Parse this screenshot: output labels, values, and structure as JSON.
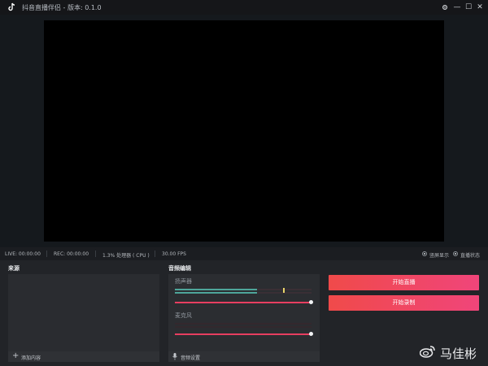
{
  "titlebar": {
    "title": "抖音直播伴侣 - 版本: 0.1.0",
    "buttons": {
      "settings_icon": "gear-icon",
      "minimize": "—",
      "maximize": "☐",
      "close": "✕"
    }
  },
  "statusbar": {
    "live": "LIVE: 00:00:00",
    "rec": "REC: 00:00:00",
    "cpu": "1.3% 处理器 ( CPU )",
    "fps": "30.00 FPS",
    "options": [
      {
        "label": "竖屏显示",
        "selected": true
      },
      {
        "label": "直播状态",
        "selected": true
      }
    ]
  },
  "sources": {
    "title": "来源",
    "add_label": "添加内容"
  },
  "audio": {
    "title": "音频编辑",
    "channels": [
      {
        "name": "扬声器",
        "meter_level": 0.6,
        "volume": 1.0
      },
      {
        "name": "麦克风",
        "meter_level": 0.0,
        "volume": 1.0
      }
    ],
    "settings_label": "音频设置"
  },
  "actions": {
    "start_live": "开始直播",
    "start_record": "开始录制"
  },
  "watermark": {
    "text": "马佳彬"
  },
  "colors": {
    "accent": "#f0457a",
    "meter_green": "#4ea59a",
    "slider": "#e63e60"
  }
}
